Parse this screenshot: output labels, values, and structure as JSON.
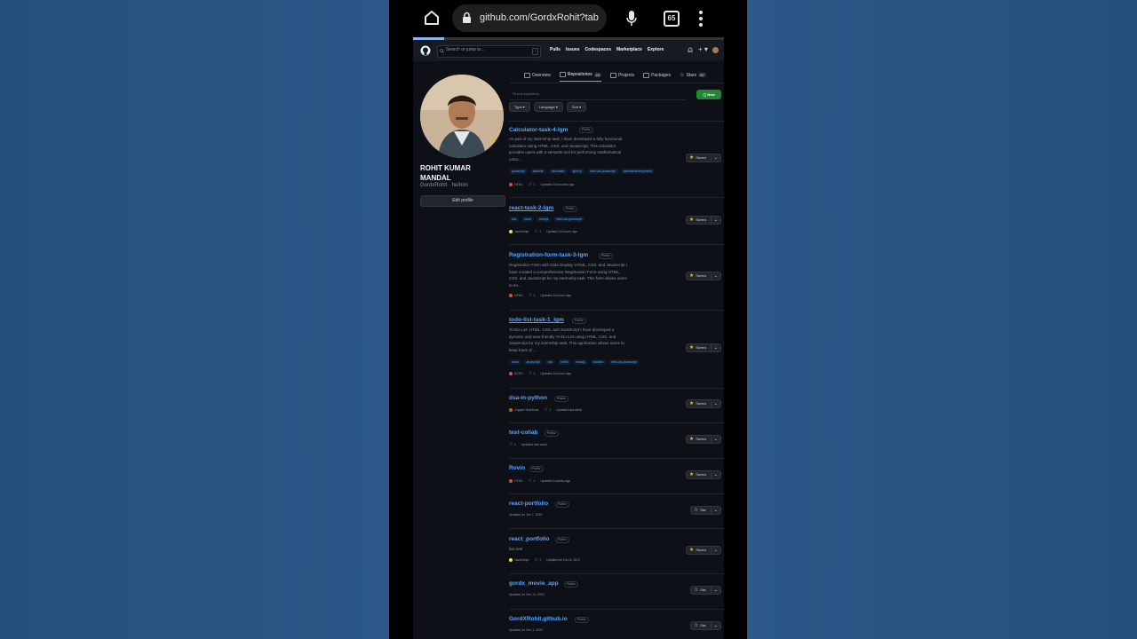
{
  "browser": {
    "url": "github.com/GordxRohit?tab",
    "tab_count": "65",
    "progress": 0.1
  },
  "gh_header": {
    "search_placeholder": "Search or jump to...",
    "slash_hint": "/",
    "nav": [
      "Pulls",
      "Issues",
      "Codespaces",
      "Marketplace",
      "Explore"
    ],
    "plus": "+ ▾"
  },
  "tabs": [
    {
      "label": "Overview",
      "count": ""
    },
    {
      "label": "Repositories",
      "count": "20"
    },
    {
      "label": "Projects",
      "count": ""
    },
    {
      "label": "Packages",
      "count": ""
    },
    {
      "label": "Stars",
      "count": "87"
    }
  ],
  "profile": {
    "name": "ROHIT KUMAR MANDAL",
    "handle": "GordxRohit · he/him",
    "edit_button": "Edit profile"
  },
  "filters": {
    "find_placeholder": "Find a repository...",
    "new_button": "New",
    "type": "Type",
    "language": "Language",
    "sort": "Sort"
  },
  "repos": [
    {
      "name": "Calculator-task-4-lgm",
      "visibility": "Public",
      "underline": false,
      "description": "As part of my internship task, I have developed a fully functional calculator using HTML, CSS, and JavaScript. This calculator provides users with a versatile tool for performing mathematical calcu...",
      "topics": [
        "javascript",
        "website",
        "calculator",
        "lgmvip",
        "html-css-javascript",
        "websitedevelopment"
      ],
      "language": "HTML",
      "lang_color": "#e34c26",
      "stars": "1",
      "updated": "Updated 18 minutes ago",
      "starred": true,
      "star_label": "Starred"
    },
    {
      "name": "react-task-2-lgm",
      "visibility": "Public",
      "underline": true,
      "description": "",
      "topics": [
        "css",
        "react",
        "reactjs",
        "html-css-javascript"
      ],
      "language": "JavaScript",
      "lang_color": "#f1e05a",
      "stars": "1",
      "updated": "Updated 16 hours ago",
      "starred": true,
      "star_label": "Starred"
    },
    {
      "name": "Registration-form-task-3-lgm",
      "visibility": "Public",
      "underline": false,
      "description": "Registration Form with Data Display: HTML, CSS, and JavaScript I have created a comprehensive Registration Form using HTML, CSS, and JavaScript for my internship task. This form allows users to en...",
      "topics": [],
      "language": "HTML",
      "lang_color": "#e34c26",
      "stars": "1",
      "updated": "Updated 16 hours ago",
      "starred": true,
      "star_label": "Starred"
    },
    {
      "name": "todo-list-task-1_lgm",
      "visibility": "Public",
      "underline": true,
      "description": "To-Do List: HTML, CSS, and JavaScript I have developed a dynamic and user-friendly To-Do List using HTML, CSS, and JavaScript for my internship task. This application allows users to keep track of ...",
      "topics": [
        "react",
        "javascript",
        "css",
        "html5",
        "reactjs",
        "todolist",
        "html-css-javascript"
      ],
      "language": "SCSS",
      "lang_color": "#c6538c",
      "stars": "1",
      "updated": "Updated 16 hours ago",
      "starred": true,
      "star_label": "Starred"
    },
    {
      "name": "dsa-in-python",
      "visibility": "Public",
      "underline": false,
      "description": "",
      "topics": [],
      "language": "Jupyter Notebook",
      "lang_color": "#da5b0b",
      "stars": "1",
      "updated": "Updated last week",
      "starred": true,
      "star_label": "Starred"
    },
    {
      "name": "test-collab",
      "visibility": "Public",
      "underline": false,
      "description": "",
      "topics": [],
      "language": "",
      "lang_color": "",
      "stars": "1",
      "updated": "Updated last week",
      "starred": true,
      "star_label": "Starred"
    },
    {
      "name": "Rovin",
      "visibility": "Public",
      "underline": false,
      "description": "",
      "topics": [],
      "language": "HTML",
      "lang_color": "#e34c26",
      "stars": "1",
      "updated": "Updated 3 weeks ago",
      "starred": true,
      "star_label": "Starred"
    },
    {
      "name": "react-portfolio",
      "visibility": "Public",
      "underline": false,
      "description": "",
      "topics": [],
      "language": "",
      "lang_color": "",
      "stars": "",
      "updated": "Updated on Jan 7, 2023",
      "starred": false,
      "star_label": "Star"
    },
    {
      "name": "react_portfolio",
      "visibility": "Public",
      "underline": false,
      "description": "live test",
      "topics": [],
      "language": "JavaScript",
      "lang_color": "#f1e05a",
      "stars": "1",
      "updated": "Updated on Dec 8, 2022",
      "starred": true,
      "star_label": "Starred"
    },
    {
      "name": "gordx_movie_app",
      "visibility": "Public",
      "underline": false,
      "description": "",
      "topics": [],
      "language": "",
      "lang_color": "",
      "stars": "",
      "updated": "Updated on Nov 14, 2022",
      "starred": false,
      "star_label": "Star"
    },
    {
      "name": "GordXRohit.github.io",
      "visibility": "Public",
      "underline": false,
      "description": "",
      "topics": [],
      "language": "",
      "lang_color": "",
      "stars": "",
      "updated": "Updated on Nov 1, 2022",
      "starred": false,
      "star_label": "Star"
    }
  ],
  "colors": {
    "link": "#58a6ff",
    "bg": "#0d1117",
    "new_button": "#238636",
    "star_on": "#e3b341",
    "backdrop": "#2a5585"
  }
}
